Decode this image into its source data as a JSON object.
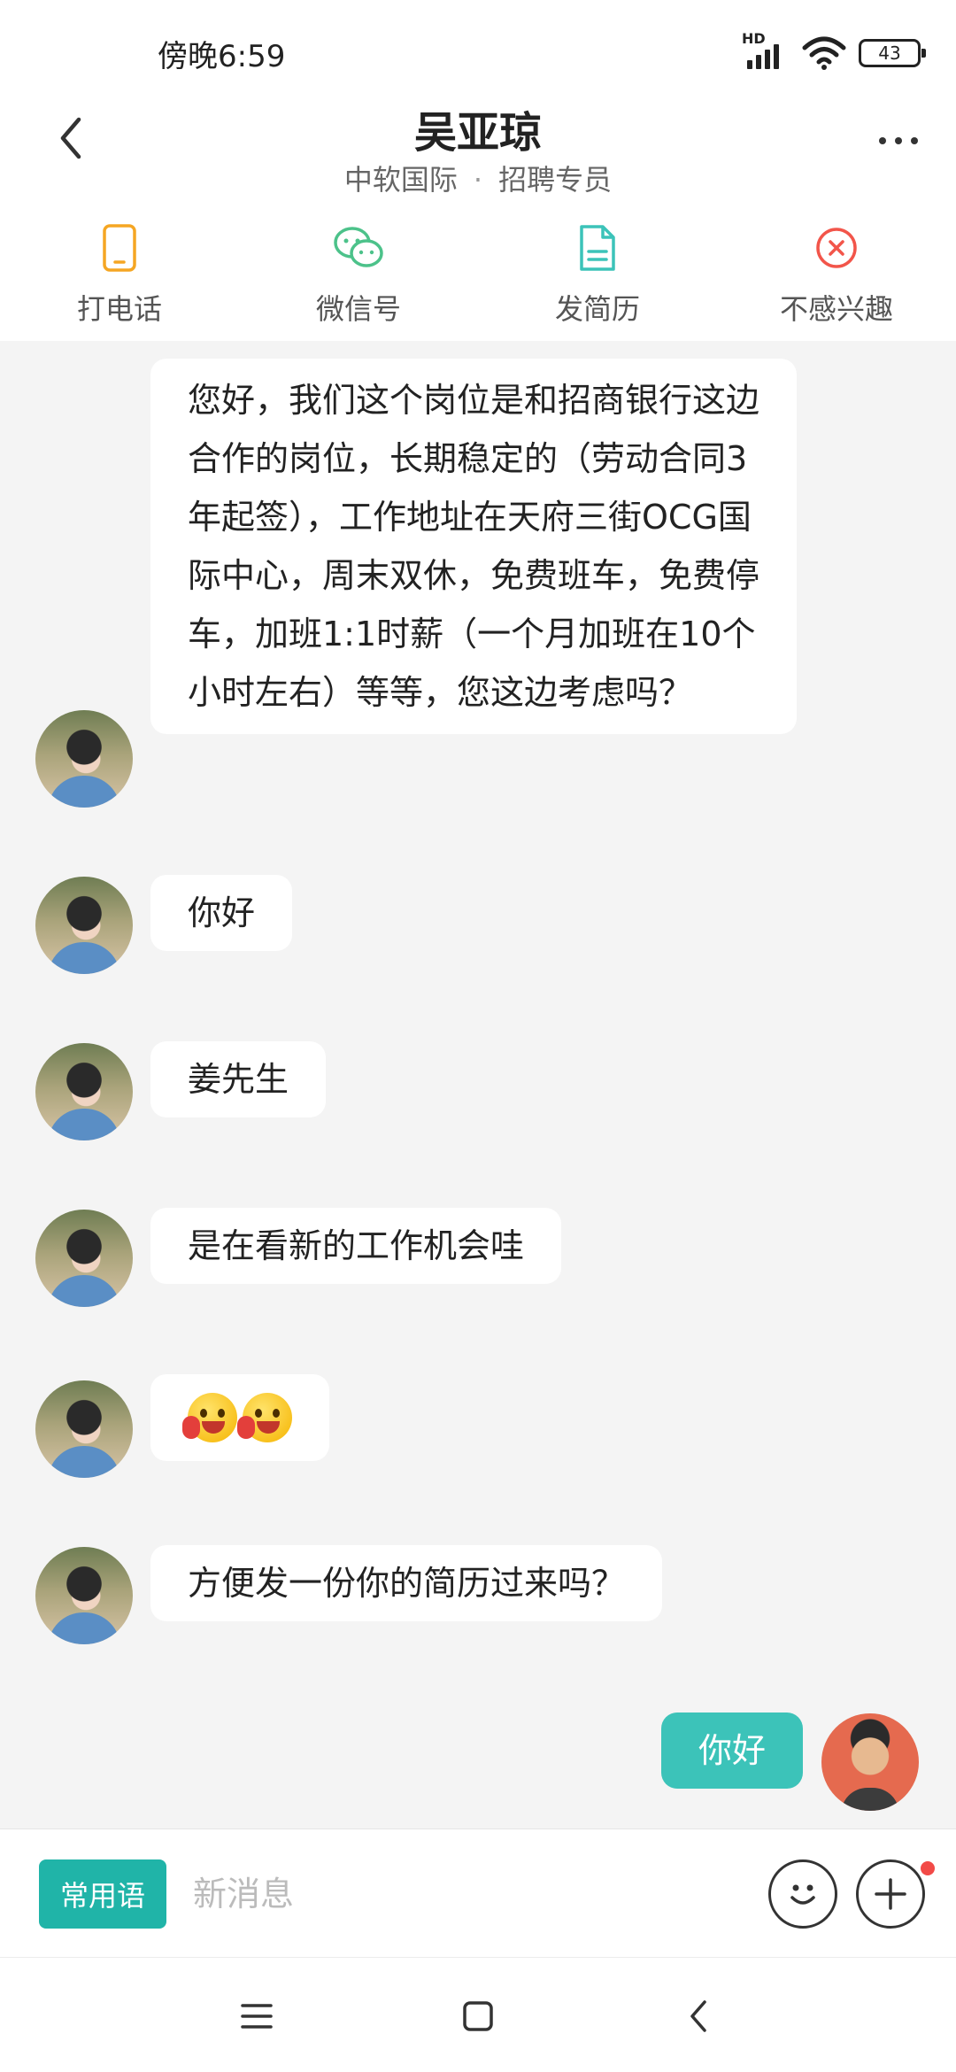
{
  "status_bar": {
    "time": "傍晚6:59",
    "network_label": "HD",
    "battery": "43"
  },
  "header": {
    "name": "吴亚琼",
    "company": "中软国际",
    "separator": "·",
    "role": "招聘专员"
  },
  "actions": [
    {
      "label": "打电话",
      "icon": "phone-icon",
      "color": "#f5a623"
    },
    {
      "label": "微信号",
      "icon": "wechat-icon",
      "color": "#4cc28a"
    },
    {
      "label": "发简历",
      "icon": "resume-icon",
      "color": "#3cc3b9"
    },
    {
      "label": "不感兴趣",
      "icon": "not-interested-icon",
      "color": "#f2554a"
    }
  ],
  "messages": [
    {
      "sender": "recruiter",
      "text": "您好，我们这个岗位是和招商银行这边合作的岗位，长期稳定的（劳动合同3年起签），工作地址在天府三街OCG国际中心，周末双休，免费班车，免费停车，加班1:1时薪（一个月加班在10个小时左右）等等，您这边考虑吗？"
    },
    {
      "sender": "recruiter",
      "text": "你好"
    },
    {
      "sender": "recruiter",
      "text": "姜先生"
    },
    {
      "sender": "recruiter",
      "text": "是在看新的工作机会哇"
    },
    {
      "sender": "recruiter",
      "type": "emoji",
      "emojis": [
        "tongue-out-emoji",
        "tongue-out-emoji"
      ]
    },
    {
      "sender": "recruiter",
      "text": "方便发一份你的简历过来吗？"
    },
    {
      "sender": "self",
      "text": "你好"
    }
  ],
  "input_bar": {
    "phrases_label": "常用语",
    "placeholder": "新消息"
  },
  "colors": {
    "accent": "#20b4a8",
    "self_bubble": "#3cc3b9",
    "notification_dot": "#f24a47"
  }
}
